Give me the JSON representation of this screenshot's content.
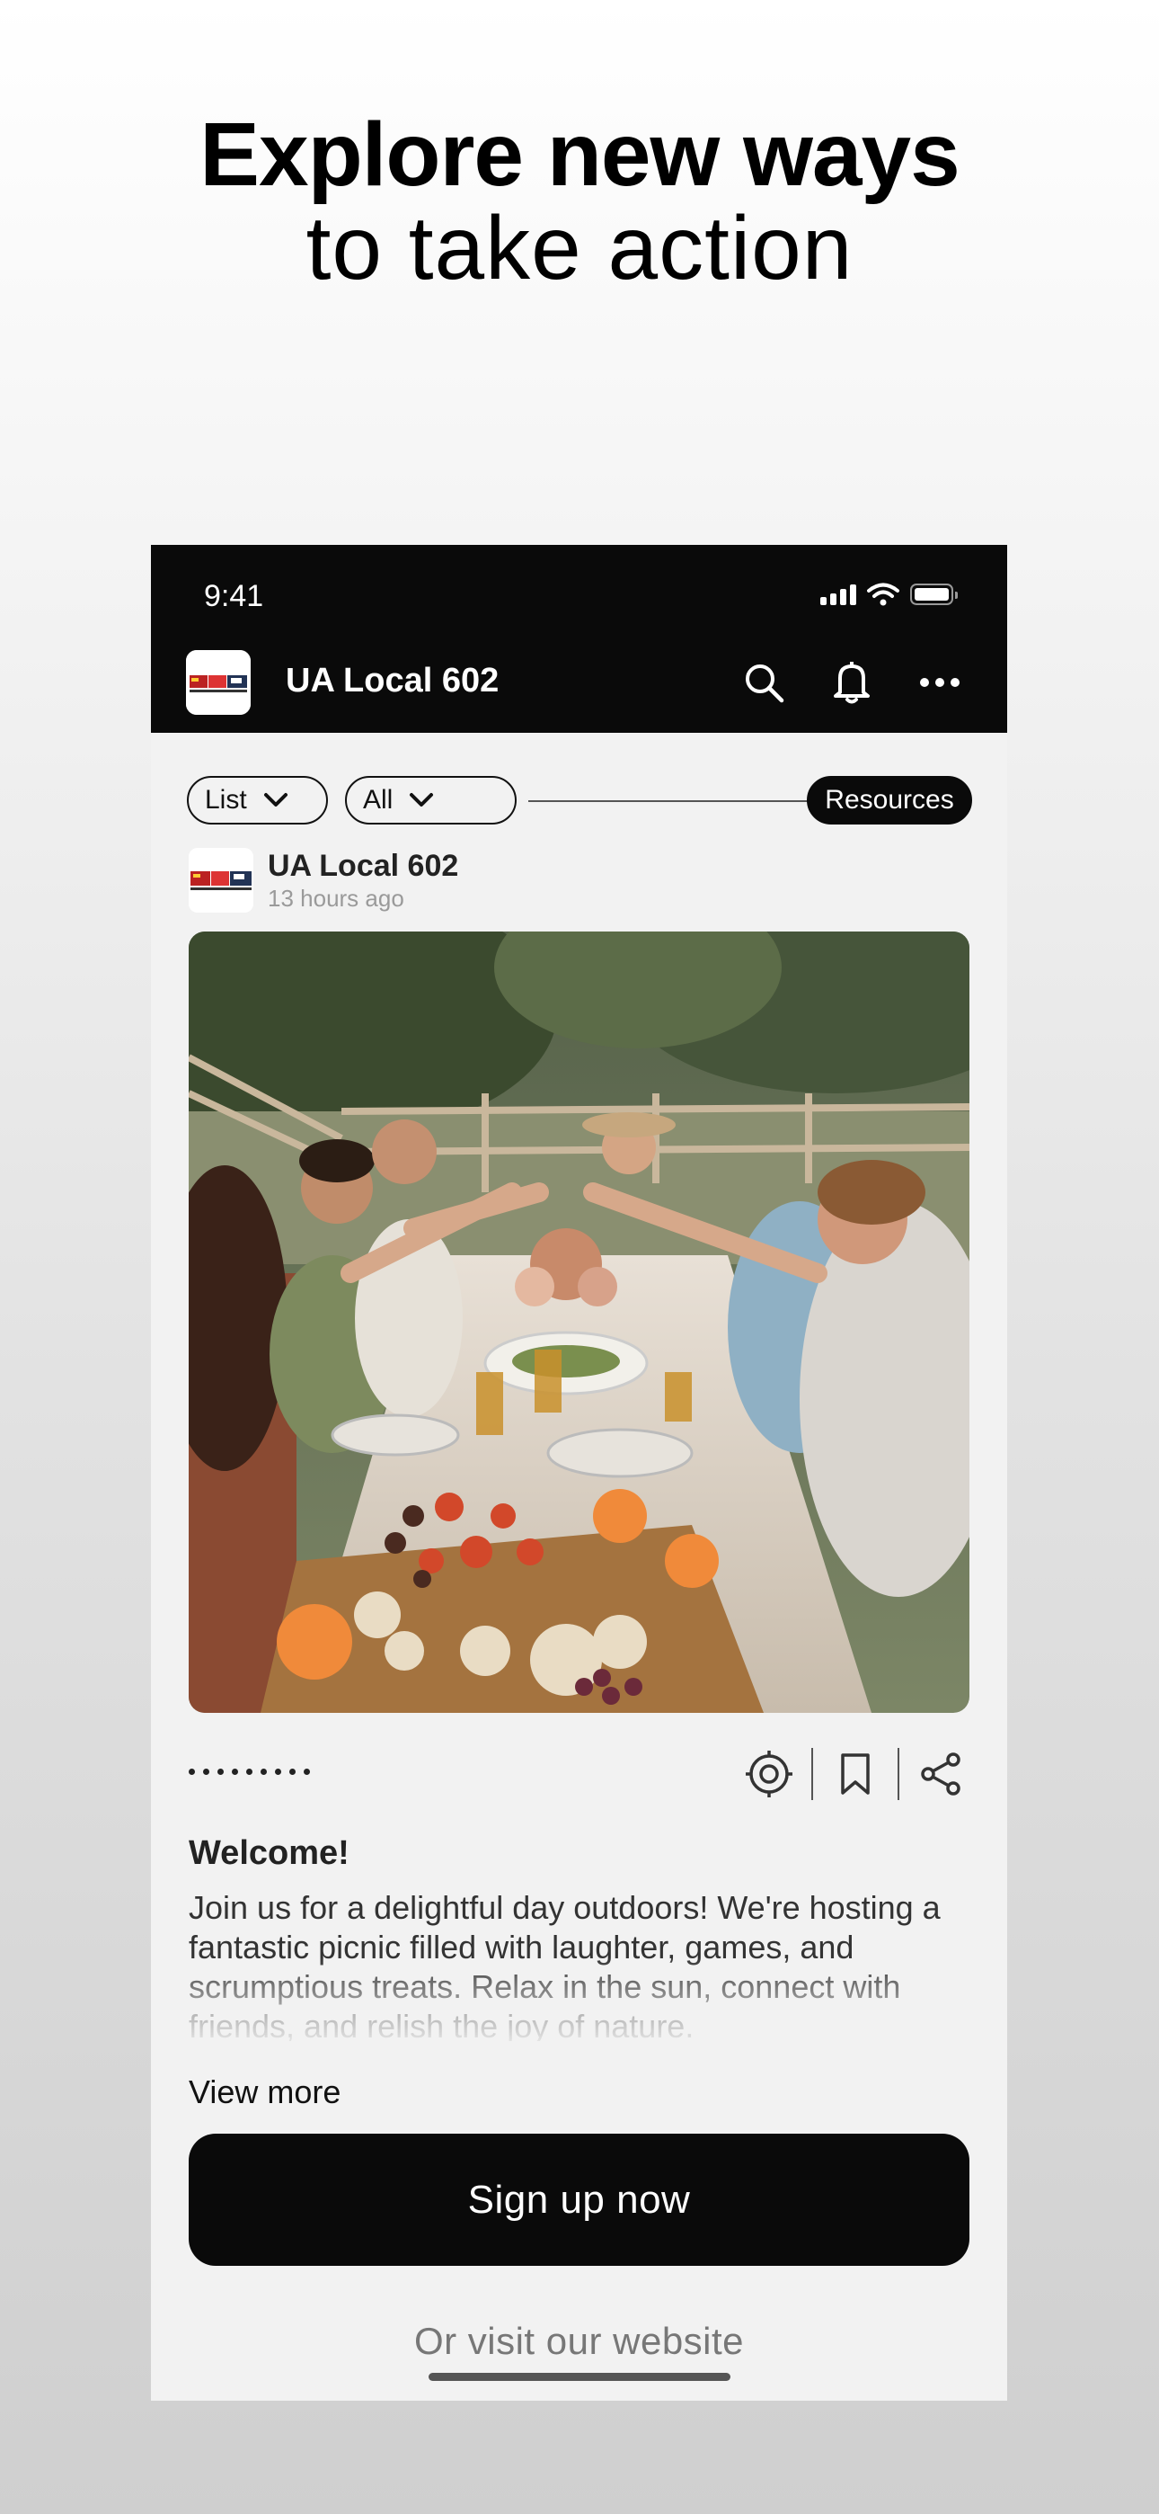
{
  "headline": {
    "line1": "Explore new ways",
    "line2": "to take action"
  },
  "status_bar": {
    "time": "9:41"
  },
  "header": {
    "title": "UA Local 602",
    "icons": [
      "search-icon",
      "bell-icon",
      "more-icon"
    ]
  },
  "filters": {
    "list_label": "List",
    "all_label": "All",
    "resources_label": "Resources"
  },
  "post": {
    "author": "UA Local 602",
    "time": "13 hours ago",
    "carousel_pages": 9,
    "title": "Welcome!",
    "body": "Join us for a delightful day outdoors! We're hosting a fantastic picnic filled with laughter, games, and scrumptious treats. Relax in the sun, connect with friends, and relish the joy of nature.",
    "view_more": "View more",
    "actions": [
      "target-icon",
      "bookmark-icon",
      "share-icon"
    ]
  },
  "cta": {
    "primary": "Sign up now",
    "secondary": "Or visit our website"
  },
  "colors": {
    "dark": "#0a0a0a",
    "panel": "#f2f2f2",
    "muted": "#9a9a9a"
  }
}
